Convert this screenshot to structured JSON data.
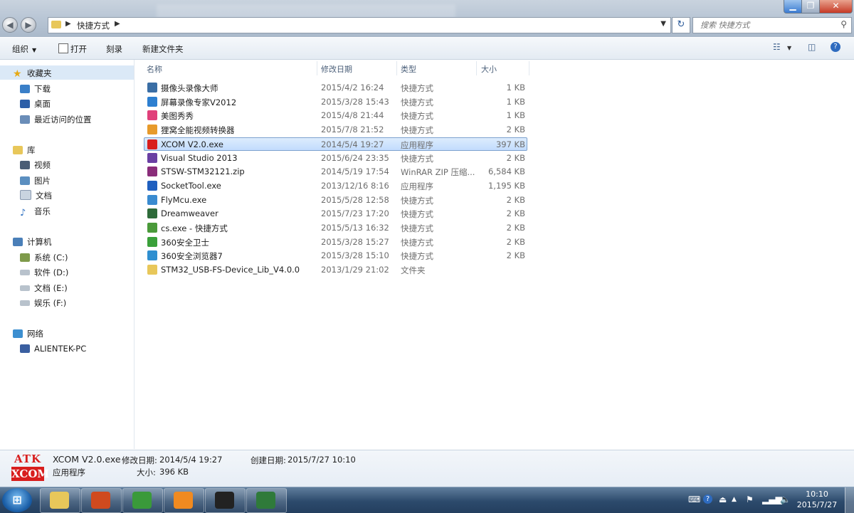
{
  "address": {
    "crumb": "快捷方式",
    "sep1": "▶",
    "sep2": "▶"
  },
  "search": {
    "placeholder": "搜索 快捷方式"
  },
  "toolbar": {
    "organize": "组织",
    "open": "打开",
    "burn": "刻录",
    "new_folder": "新建文件夹"
  },
  "nav": {
    "favorites": "收藏夹",
    "fav_items": [
      "下载",
      "桌面",
      "最近访问的位置"
    ],
    "libraries": "库",
    "lib_items": [
      "视频",
      "图片",
      "文档",
      "音乐"
    ],
    "computer": "计算机",
    "drives": [
      "系统 (C:)",
      "软件 (D:)",
      "文档 (E:)",
      "娱乐 (F:)"
    ],
    "network": "网络",
    "net_items": [
      "ALIENTEK-PC"
    ]
  },
  "columns": {
    "name": "名称",
    "date": "修改日期",
    "type": "类型",
    "size": "大小"
  },
  "files": [
    {
      "name": "摄像头录像大师",
      "date": "2015/4/2 16:24",
      "type": "快捷方式",
      "size": "1 KB",
      "color": "#3a6ea5"
    },
    {
      "name": "屏幕录像专家V2012",
      "date": "2015/3/28 15:43",
      "type": "快捷方式",
      "size": "1 KB",
      "color": "#2d7fd0"
    },
    {
      "name": "美图秀秀",
      "date": "2015/4/8 21:44",
      "type": "快捷方式",
      "size": "1 KB",
      "color": "#e0407a"
    },
    {
      "name": "狸窝全能视频转换器",
      "date": "2015/7/8 21:52",
      "type": "快捷方式",
      "size": "2 KB",
      "color": "#e79a2b"
    },
    {
      "name": "XCOM V2.0.exe",
      "date": "2014/5/4 19:27",
      "type": "应用程序",
      "size": "397 KB",
      "color": "#d81e1e"
    },
    {
      "name": "Visual Studio 2013",
      "date": "2015/6/24 23:35",
      "type": "快捷方式",
      "size": "2 KB",
      "color": "#6a3fa3"
    },
    {
      "name": "STSW-STM32121.zip",
      "date": "2014/5/19 17:54",
      "type": "WinRAR ZIP 压缩...",
      "size": "6,584 KB",
      "color": "#8a2d7a"
    },
    {
      "name": "SocketTool.exe",
      "date": "2013/12/16 8:16",
      "type": "应用程序",
      "size": "1,195 KB",
      "color": "#1f5fbf"
    },
    {
      "name": "FlyMcu.exe",
      "date": "2015/5/28 12:58",
      "type": "快捷方式",
      "size": "2 KB",
      "color": "#3a8bd0"
    },
    {
      "name": "Dreamweaver",
      "date": "2015/7/23 17:20",
      "type": "快捷方式",
      "size": "2 KB",
      "color": "#2e6b3a"
    },
    {
      "name": "cs.exe - 快捷方式",
      "date": "2015/5/13 16:32",
      "type": "快捷方式",
      "size": "2 KB",
      "color": "#4a9a3a"
    },
    {
      "name": "360安全卫士",
      "date": "2015/3/28 15:27",
      "type": "快捷方式",
      "size": "2 KB",
      "color": "#3aa03a"
    },
    {
      "name": "360安全浏览器7",
      "date": "2015/3/28 15:10",
      "type": "快捷方式",
      "size": "2 KB",
      "color": "#2f8fd0"
    },
    {
      "name": "STM32_USB-FS-Device_Lib_V4.0.0",
      "date": "2013/1/29 21:02",
      "type": "文件夹",
      "size": "",
      "color": "#e8c75a"
    }
  ],
  "selected_index": 4,
  "details": {
    "logo_top": "ATK",
    "logo_bottom": "XCOM",
    "name": "XCOM V2.0.exe",
    "modified_label": "修改日期:",
    "modified": "2014/5/4 19:27",
    "created_label": "创建日期:",
    "created": "2015/7/27 10:10",
    "type": "应用程序",
    "size_label": "大小:",
    "size": "396 KB"
  },
  "taskbar": {
    "apps": [
      {
        "name": "explorer",
        "color": "#e8c75a"
      },
      {
        "name": "powerpoint",
        "color": "#d04a1f"
      },
      {
        "name": "green-app",
        "color": "#3a9a3a"
      },
      {
        "name": "pdf",
        "color": "#f08a20"
      },
      {
        "name": "camera",
        "color": "#222222"
      },
      {
        "name": "v5",
        "color": "#2f7a3a"
      }
    ],
    "time": "10:10",
    "date": "2015/7/27"
  }
}
